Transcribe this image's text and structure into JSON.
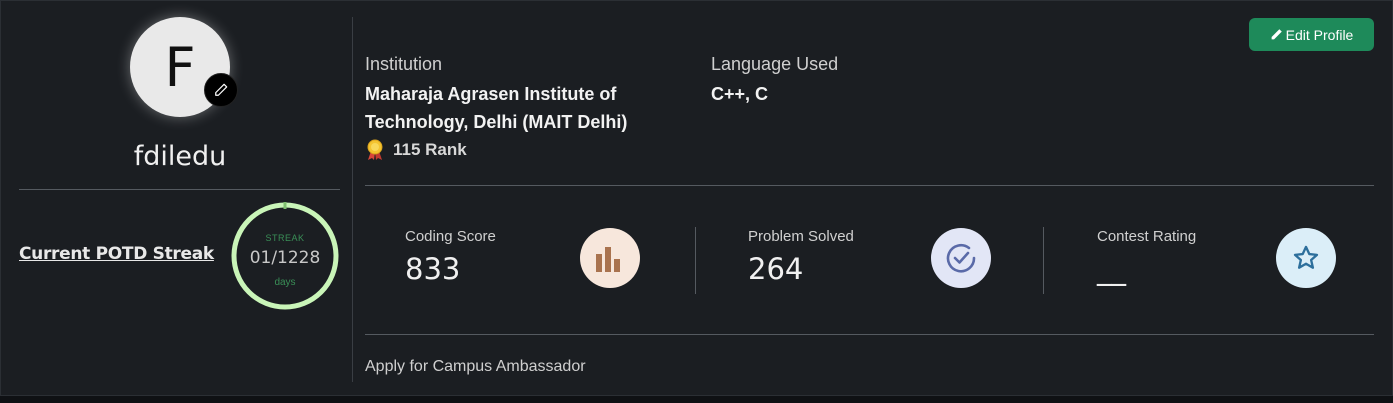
{
  "profile": {
    "avatar_letter": "F",
    "username": "fdiledu",
    "edit_profile_label": "Edit Profile"
  },
  "potd": {
    "link_label": "Current POTD Streak",
    "streak_label": "STREAK",
    "streak_value": "01/1228",
    "streak_unit": "days",
    "ring_progress": 0.0008
  },
  "info": {
    "institution_label": "Institution",
    "institution_value": "Maharaja Agrasen Institute of Technology, Delhi (MAIT Delhi)",
    "language_label": "Language Used",
    "language_value": "C++, C",
    "rank_value": "115 Rank"
  },
  "stats": [
    {
      "label": "Coding Score",
      "value": "833",
      "icon": "bar-chart-icon",
      "icon_bg": "#f7e7dc",
      "icon_color": "#a9734f"
    },
    {
      "label": "Problem Solved",
      "value": "264",
      "icon": "check-circle-icon",
      "icon_bg": "#e2e6f6",
      "icon_color": "#5a6aa8"
    },
    {
      "label": "Contest Rating",
      "value": "__",
      "icon": "star-icon",
      "icon_bg": "#dbeef8",
      "icon_color": "#2d6f9c"
    }
  ],
  "footer": {
    "ambassador_label": "Apply for Campus Ambassador"
  },
  "colors": {
    "accent_green": "#1e8a5a",
    "streak_ring": "#c9f5b8",
    "card_bg": "#1b1e22"
  }
}
